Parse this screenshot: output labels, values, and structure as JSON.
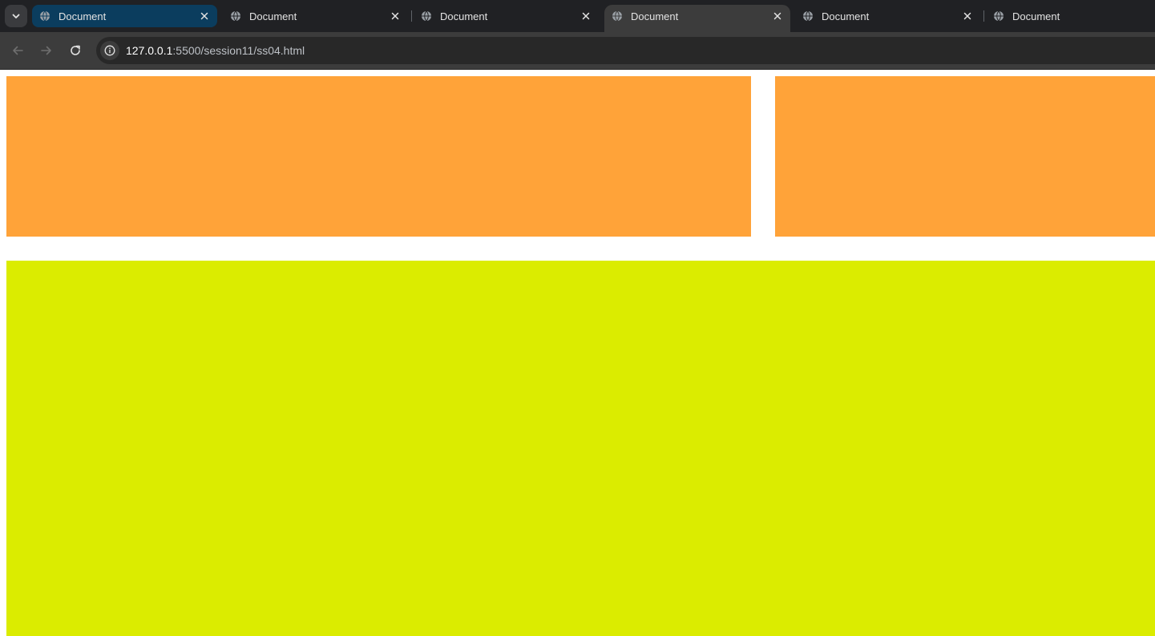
{
  "browser": {
    "tabs": [
      {
        "title": "Document",
        "state": "highlighted",
        "favicon": "globe-icon"
      },
      {
        "title": "Document",
        "state": "normal",
        "favicon": "globe-icon"
      },
      {
        "title": "Document",
        "state": "normal",
        "favicon": "globe-icon"
      },
      {
        "title": "Document",
        "state": "active",
        "favicon": "globe-icon"
      },
      {
        "title": "Document",
        "state": "normal",
        "favicon": "globe-icon"
      },
      {
        "title": "Document",
        "state": "normal",
        "favicon": "globe-icon"
      }
    ],
    "address_bar": {
      "host": "127.0.0.1",
      "path": ":5500/session11/ss04.html",
      "icon": "info-icon"
    },
    "nav_icons": [
      "back-arrow-icon",
      "forward-arrow-icon",
      "reload-icon"
    ]
  },
  "page": {
    "boxes": [
      {
        "name": "box-one",
        "color": "#ffa339"
      },
      {
        "name": "box-two",
        "color": "#ffa339"
      },
      {
        "name": "box-three",
        "color": "#dbec00"
      }
    ]
  },
  "colors": {
    "tabstrip_bg": "#202124",
    "toolbar_bg": "#3c3c3c",
    "highlight_tab_bg": "#0b3d5e",
    "orange": "#ffa339",
    "yellow": "#dbec00"
  }
}
